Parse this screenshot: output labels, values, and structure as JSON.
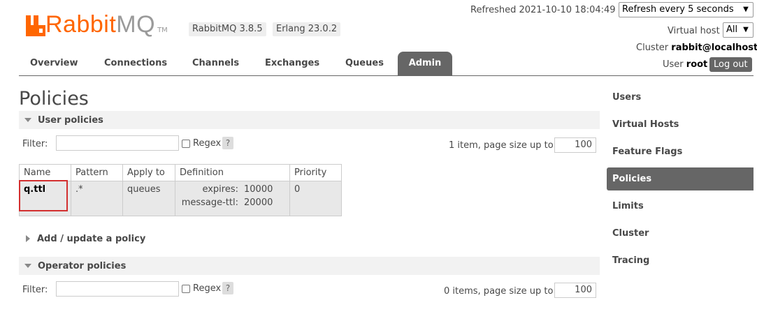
{
  "header": {
    "logo": {
      "rabbit": "Rabbit",
      "mq": "MQ",
      "tm": "TM"
    },
    "version_badges": [
      "RabbitMQ 3.8.5",
      "Erlang 23.0.2"
    ],
    "refreshed_text": "Refreshed 2021-10-10 18:04:49",
    "refresh_select_value": "Refresh every 5 seconds",
    "virtual_host_label": "Virtual host",
    "virtual_host_value": "All",
    "cluster_label": "Cluster",
    "cluster_value": "rabbit@localhost",
    "user_label": "User",
    "user_value": "root",
    "logout_label": "Log out"
  },
  "tabs": [
    "Overview",
    "Connections",
    "Channels",
    "Exchanges",
    "Queues",
    "Admin"
  ],
  "active_tab": "Admin",
  "page_title": "Policies",
  "user_policies": {
    "section_label": "User policies",
    "filter_label": "Filter:",
    "filter_value": "",
    "regex_label": "Regex",
    "help_label": "?",
    "pagination_text": "1 item, page size up to",
    "page_size": "100",
    "columns": [
      "Name",
      "Pattern",
      "Apply to",
      "Definition",
      "Priority"
    ],
    "rows": [
      {
        "name": "q.ttl",
        "pattern": ".*",
        "apply_to": "queues",
        "definition": [
          {
            "key": "expires:",
            "value": "10000"
          },
          {
            "key": "message-ttl:",
            "value": "20000"
          }
        ],
        "priority": "0"
      }
    ]
  },
  "add_update_policy_label": "Add / update a policy",
  "operator_policies": {
    "section_label": "Operator policies",
    "filter_label": "Filter:",
    "filter_value": "",
    "regex_label": "Regex",
    "help_label": "?",
    "pagination_text": "0 items, page size up to",
    "page_size": "100"
  },
  "sidebar": {
    "items": [
      "Users",
      "Virtual Hosts",
      "Feature Flags",
      "Policies",
      "Limits",
      "Cluster",
      "Tracing"
    ],
    "active": "Policies"
  },
  "colors": {
    "brand_orange": "#ff6600",
    "tab_active_bg": "#666666",
    "highlight_box": "#d32f2f"
  },
  "icons": [
    "rabbit-logo-icon",
    "chevron-down-icon",
    "triangle-down-icon",
    "triangle-right-icon",
    "help-icon",
    "checkbox-icon"
  ]
}
